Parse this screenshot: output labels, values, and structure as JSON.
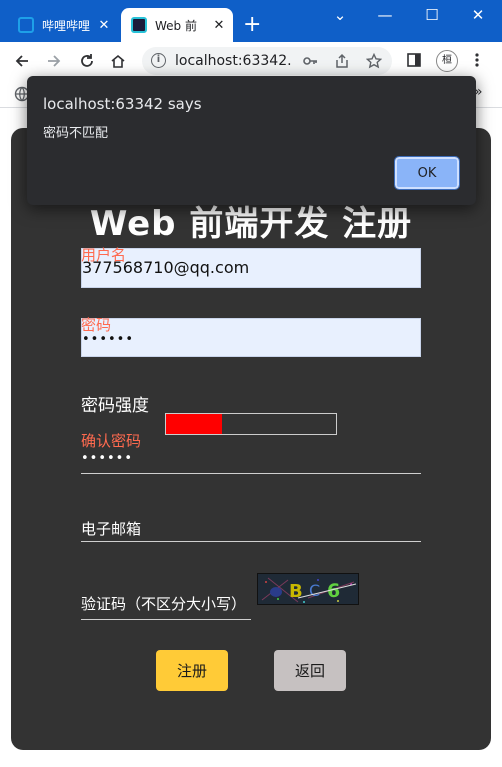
{
  "browser": {
    "tabs": [
      {
        "title": "哔哩哔哩",
        "close": "✕"
      },
      {
        "title": "Web 前",
        "close": "✕"
      }
    ],
    "new_tab": "+",
    "window_controls": {
      "minimize": "⌄",
      "min": "—",
      "max": "☐",
      "close": "✕"
    },
    "address": "localhost:63342...",
    "profile_initial": "桓"
  },
  "page": {
    "title": "Web 前端开发 注册",
    "username_label": "用户名",
    "username_value": "377568710@qq.com",
    "password_label": "密码",
    "password_value": "••••••",
    "strength_label": "密码强度",
    "strength_level": 0.33,
    "strength_color": "#ff0000",
    "confirm_label": "确认密码",
    "confirm_value": "••••••",
    "email_label": "电子邮箱",
    "captcha_label": "验证码（不区分大小写）",
    "captcha_chars": [
      "B",
      "C",
      "6"
    ],
    "register_button": "注册",
    "back_button": "返回",
    "accent_color": "#ffcb37",
    "panel_color": "#333333"
  },
  "alert": {
    "origin": "localhost:63342 says",
    "message": "密码不匹配",
    "ok_button": "OK"
  }
}
